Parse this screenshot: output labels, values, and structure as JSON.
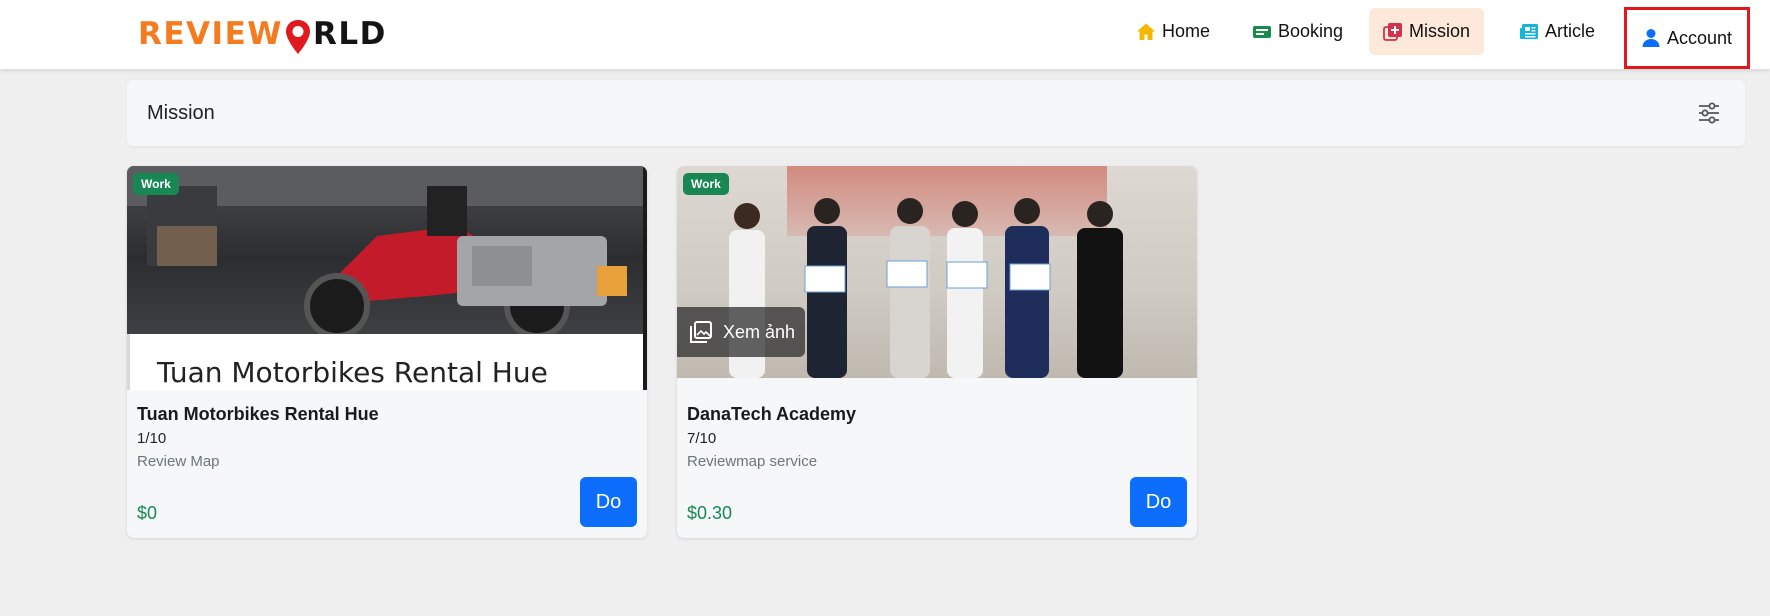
{
  "brand": {
    "logo_left": "REVIEW",
    "logo_right": "RLD"
  },
  "nav": {
    "home": "Home",
    "booking": "Booking",
    "mission": "Mission",
    "article": "Article",
    "account": "Account"
  },
  "mission_bar": {
    "title": "Mission"
  },
  "cards": [
    {
      "badge": "Work",
      "image_caption": "Tuan Motorbikes Rental Hue",
      "name": "Tuan Motorbikes Rental Hue",
      "progress": "1/10",
      "type": "Review Map",
      "price": "$0",
      "action": "Do"
    },
    {
      "badge": "Work",
      "image_overlay": "Xem ảnh",
      "name": "DanaTech Academy",
      "progress": "7/10",
      "type": "Reviewmap service",
      "price": "$0.30",
      "action": "Do"
    }
  ],
  "colors": {
    "accent": "#0d6efd",
    "brand_orange": "#f47b20",
    "active_nav_bg": "#fde8d9",
    "badge_green": "#198754",
    "highlight_border": "#e0191f"
  },
  "icons": {
    "home": "home-icon",
    "booking": "ticket-icon",
    "mission": "mission-icon",
    "article": "newspaper-icon",
    "account": "user-icon",
    "filter": "sliders-icon",
    "gallery": "image-gallery-icon",
    "logo_pin": "map-pin-icon"
  }
}
